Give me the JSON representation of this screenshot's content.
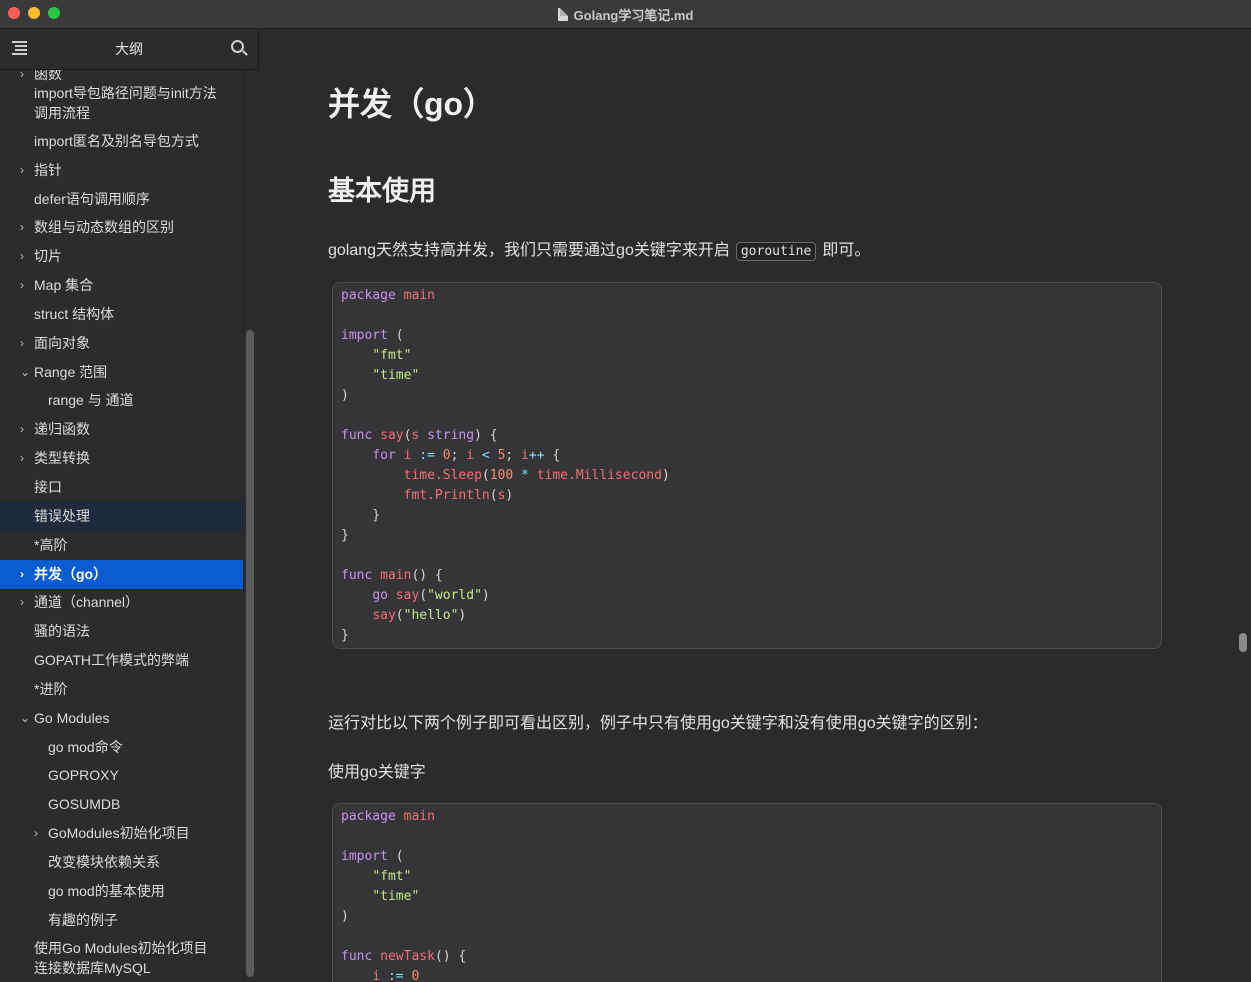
{
  "window": {
    "title": "Golang学习笔记.md"
  },
  "sidebar": {
    "title": "大纲",
    "items": [
      {
        "label": "函数",
        "chevron": "›"
      },
      {
        "label": "import导包路径问题与init方法",
        "chevron": ""
      },
      {
        "label": "调用流程",
        "chevron": ""
      },
      {
        "label": "import匿名及别名导包方式",
        "chevron": ""
      },
      {
        "label": "指针",
        "chevron": "›"
      },
      {
        "label": "defer语句调用顺序",
        "chevron": ""
      },
      {
        "label": "数组与动态数组的区别",
        "chevron": "›"
      },
      {
        "label": "切片",
        "chevron": "›"
      },
      {
        "label": "Map 集合",
        "chevron": "›"
      },
      {
        "label": "struct 结构体",
        "chevron": ""
      },
      {
        "label": "面向对象",
        "chevron": "›"
      },
      {
        "label": "Range 范围",
        "chevron": "⌄"
      },
      {
        "label": "range 与 通道",
        "chevron": ""
      },
      {
        "label": "递归函数",
        "chevron": "›"
      },
      {
        "label": "类型转换",
        "chevron": "›"
      },
      {
        "label": "接口",
        "chevron": ""
      },
      {
        "label": "错误处理",
        "chevron": ""
      },
      {
        "label": "*高阶",
        "chevron": ""
      },
      {
        "label": "并发（go）",
        "chevron": "›"
      },
      {
        "label": "通道（channel）",
        "chevron": "›"
      },
      {
        "label": "骚的语法",
        "chevron": ""
      },
      {
        "label": "GOPATH工作模式的弊端",
        "chevron": ""
      },
      {
        "label": "*进阶",
        "chevron": ""
      },
      {
        "label": "Go Modules",
        "chevron": "⌄"
      },
      {
        "label": "go mod命令",
        "chevron": ""
      },
      {
        "label": "GOPROXY",
        "chevron": ""
      },
      {
        "label": "GOSUMDB",
        "chevron": ""
      },
      {
        "label": "GoModules初始化项目",
        "chevron": "›"
      },
      {
        "label": "改变模块依赖关系",
        "chevron": ""
      },
      {
        "label": "go mod的基本使用",
        "chevron": ""
      },
      {
        "label": "有趣的例子",
        "chevron": ""
      },
      {
        "label": "使用Go Modules初始化项目",
        "chevron": ""
      },
      {
        "label": "连接数据库MySQL",
        "chevron": ""
      }
    ]
  },
  "content": {
    "h1": "并发（go）",
    "h2": "基本使用",
    "para1_before": "golang天然支持高并发，我们只需要通过go关键字来开启",
    "para1_code": "goroutine",
    "para1_after": "即可。",
    "code1": [
      [
        [
          "kw",
          "package"
        ],
        [
          "t",
          " "
        ],
        [
          "fn",
          "main"
        ]
      ],
      [],
      [
        [
          "kw",
          "import"
        ],
        [
          "t",
          " ("
        ]
      ],
      [
        [
          "t",
          "    "
        ],
        [
          "str",
          "\"fmt\""
        ]
      ],
      [
        [
          "t",
          "    "
        ],
        [
          "str",
          "\"time\""
        ]
      ],
      [
        [
          "t",
          ")"
        ]
      ],
      [],
      [
        [
          "kw",
          "func"
        ],
        [
          "t",
          " "
        ],
        [
          "fn",
          "say"
        ],
        [
          "t",
          "("
        ],
        [
          "var",
          "s"
        ],
        [
          "t",
          " "
        ],
        [
          "kw",
          "string"
        ],
        [
          "t",
          ") {"
        ]
      ],
      [
        [
          "t",
          "    "
        ],
        [
          "kw",
          "for"
        ],
        [
          "t",
          " "
        ],
        [
          "var",
          "i"
        ],
        [
          "t",
          " "
        ],
        [
          "op",
          ":="
        ],
        [
          "t",
          " "
        ],
        [
          "num",
          "0"
        ],
        [
          "t",
          "; "
        ],
        [
          "var",
          "i"
        ],
        [
          "t",
          " "
        ],
        [
          "op",
          "<"
        ],
        [
          "t",
          " "
        ],
        [
          "num",
          "5"
        ],
        [
          "t",
          "; "
        ],
        [
          "var",
          "i"
        ],
        [
          "op",
          "++"
        ],
        [
          "t",
          " {"
        ]
      ],
      [
        [
          "t",
          "        "
        ],
        [
          "fn",
          "time.Sleep"
        ],
        [
          "t",
          "("
        ],
        [
          "num",
          "100"
        ],
        [
          "t",
          " "
        ],
        [
          "op",
          "*"
        ],
        [
          "t",
          " "
        ],
        [
          "fn",
          "time.Millisecond"
        ],
        [
          "t",
          ")"
        ]
      ],
      [
        [
          "t",
          "        "
        ],
        [
          "fn",
          "fmt.Println"
        ],
        [
          "t",
          "("
        ],
        [
          "var",
          "s"
        ],
        [
          "t",
          ")"
        ]
      ],
      [
        [
          "t",
          "    }"
        ]
      ],
      [
        [
          "t",
          "}"
        ]
      ],
      [],
      [
        [
          "kw",
          "func"
        ],
        [
          "t",
          " "
        ],
        [
          "fn",
          "main"
        ],
        [
          "t",
          "() {"
        ]
      ],
      [
        [
          "t",
          "    "
        ],
        [
          "kw",
          "go"
        ],
        [
          "t",
          " "
        ],
        [
          "fn",
          "say"
        ],
        [
          "t",
          "("
        ],
        [
          "str",
          "\"world\""
        ],
        [
          "t",
          ")"
        ]
      ],
      [
        [
          "t",
          "    "
        ],
        [
          "fn",
          "say"
        ],
        [
          "t",
          "("
        ],
        [
          "str",
          "\"hello\""
        ],
        [
          "t",
          ")"
        ]
      ],
      [
        [
          "t",
          "}"
        ]
      ]
    ],
    "para2": "运行对比以下两个例子即可看出区别，例子中只有使用go关键字和没有使用go关键字的区别：",
    "para3": "使用go关键字",
    "code2": [
      [
        [
          "kw",
          "package"
        ],
        [
          "t",
          " "
        ],
        [
          "fn",
          "main"
        ]
      ],
      [],
      [
        [
          "kw",
          "import"
        ],
        [
          "t",
          " ("
        ]
      ],
      [
        [
          "t",
          "    "
        ],
        [
          "str",
          "\"fmt\""
        ]
      ],
      [
        [
          "t",
          "    "
        ],
        [
          "str",
          "\"time\""
        ]
      ],
      [
        [
          "t",
          ")"
        ]
      ],
      [],
      [
        [
          "kw",
          "func"
        ],
        [
          "t",
          " "
        ],
        [
          "fn",
          "newTask"
        ],
        [
          "t",
          "() {"
        ]
      ],
      [
        [
          "t",
          "    "
        ],
        [
          "var",
          "i"
        ],
        [
          "t",
          " "
        ],
        [
          "op",
          ":="
        ],
        [
          "t",
          " "
        ],
        [
          "num",
          "0"
        ]
      ]
    ]
  },
  "colors": {
    "accent": "#0a5bd0",
    "keyword": "#c792ea",
    "function": "#f07178",
    "string": "#c3e88d",
    "number": "#f78c6c"
  }
}
